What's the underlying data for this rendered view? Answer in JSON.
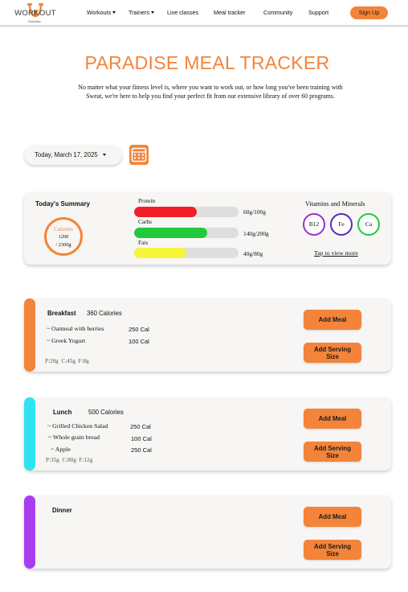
{
  "brand": {
    "name": "WORKOUT",
    "tagline": "Paradise"
  },
  "nav": {
    "items": [
      {
        "label": "Workouts",
        "dropdown": true
      },
      {
        "label": "Trainers",
        "dropdown": true
      },
      {
        "label": "Live classes",
        "dropdown": false
      },
      {
        "label": "Meal tracker",
        "dropdown": false
      },
      {
        "label": "Community",
        "dropdown": false
      },
      {
        "label": "Support",
        "dropdown": false
      }
    ],
    "signup_label": "Sign Up"
  },
  "hero": {
    "title": "PARADISE MEAL TRACKER",
    "subtitle": "No matter what your fitness level is, where you want to work out, or how long you've been training with Sweat, we're here to help you find your perfect fit from our extensive library of over 60 programs."
  },
  "date_selector": {
    "label": "Today, March 17, 2025"
  },
  "summary": {
    "title": "Today's Summary",
    "calories": {
      "label": "Calories",
      "value": "1200",
      "goal": "/ 2300g"
    },
    "macros": [
      {
        "label": "Protein",
        "value": "60g/100g",
        "fraction": 0.6,
        "color": "#f21f2a"
      },
      {
        "label": "Carbs",
        "value": "140g/200g",
        "fraction": 0.7,
        "color": "#22c93c"
      },
      {
        "label": "Fats",
        "value": "40g/80g",
        "fraction": 0.5,
        "color": "#f7f53a"
      }
    ],
    "vitamins_title": "Vitamins and Minerals",
    "vitamins": [
      {
        "label": "B12",
        "color": "#9b2fcf"
      },
      {
        "label": "Fe",
        "color": "#5a2bb8"
      },
      {
        "label": "Ca",
        "color": "#22c93c"
      }
    ],
    "view_more": "Tap to view more"
  },
  "meals": [
    {
      "name": "Breakfast",
      "calories": "360 Calories",
      "color": "#f3843a",
      "items": [
        {
          "name": "~ Oatmeal with berries",
          "cal": "250 Cal"
        },
        {
          "name": "~ Greek Yogurt",
          "cal": "100 Cal"
        }
      ],
      "macros": {
        "p": "P:20g",
        "c": "C:45g",
        "f": "F:8g"
      }
    },
    {
      "name": "Lunch",
      "calories": "500 Calories",
      "color": "#2ee4ef",
      "items": [
        {
          "name": "~ Grilled Chicken Salad",
          "cal": "250 Cal"
        },
        {
          "name": "~ Whole grain bread",
          "cal": "100 Cal"
        },
        {
          "name": "~ Apple",
          "cal": "250 Cal"
        }
      ],
      "macros": {
        "p": "P:35g",
        "c": "C:80g",
        "f": "F:12g"
      }
    },
    {
      "name": "Dinner",
      "calories": "",
      "color": "#a93ef0",
      "items": [],
      "macros": null
    }
  ],
  "actions": {
    "add_meal": "Add Meal",
    "add_serving_1": "Add Serving",
    "add_serving_2": "Size"
  }
}
